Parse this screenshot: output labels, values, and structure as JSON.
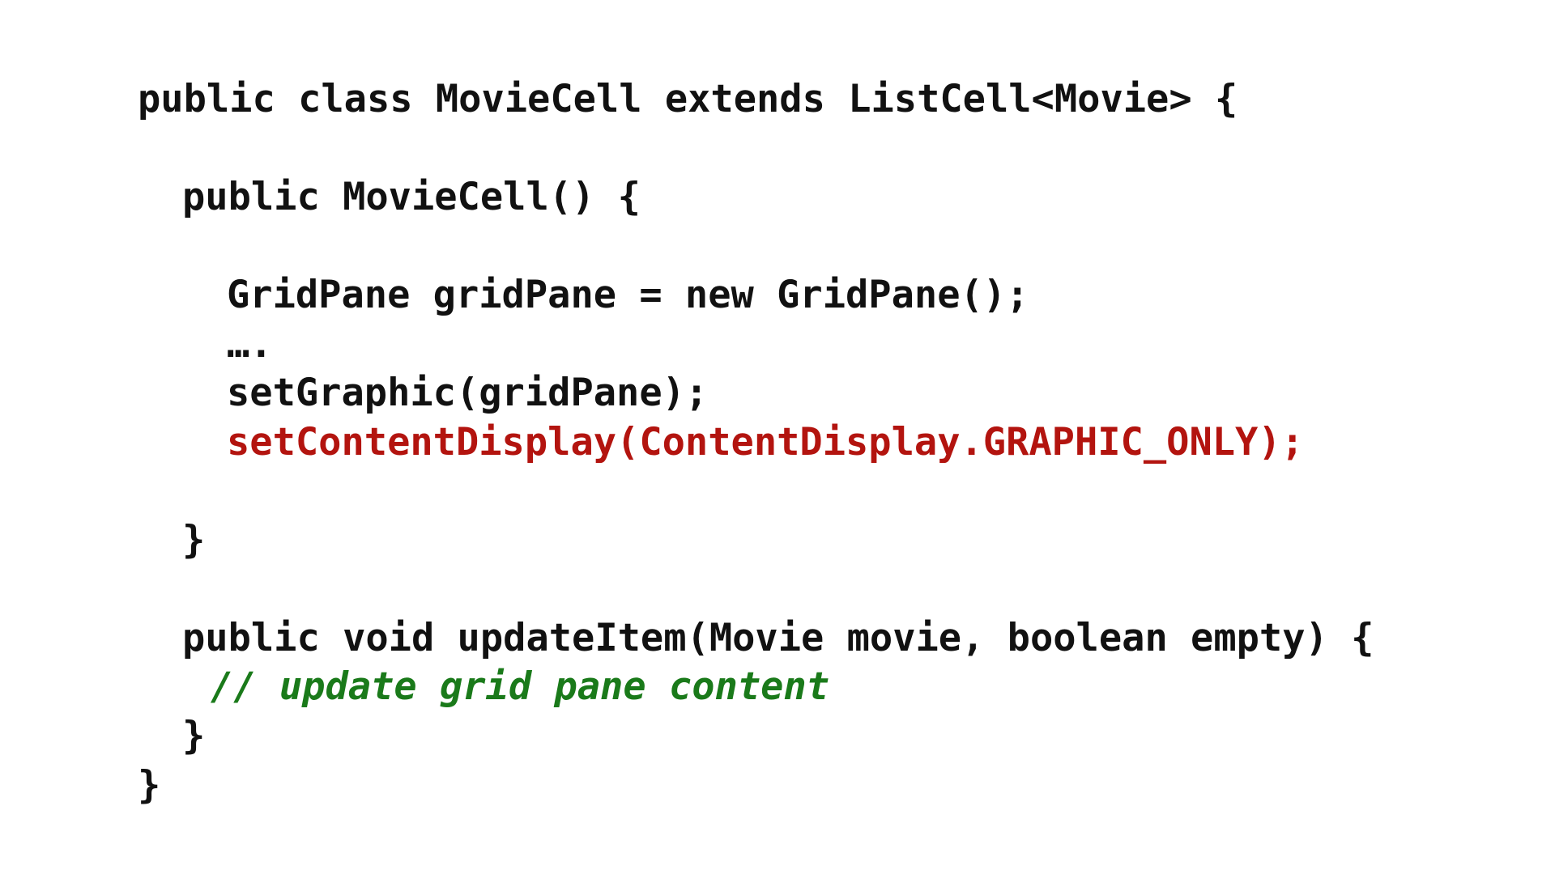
{
  "code": {
    "line_class_decl": "public class MovieCell extends ListCell<Movie> {",
    "line_constructor_decl": "public MovieCell() {",
    "line_gridpane": "GridPane gridPane = new GridPane();",
    "line_ellipsis": "….",
    "line_set_graphic": "setGraphic(gridPane);",
    "line_set_content_display": "setContentDisplay(ContentDisplay.GRAPHIC_ONLY);",
    "line_constructor_close": "}",
    "line_update_item_decl": "public void updateItem(Movie movie, boolean empty) {",
    "line_comment": "// update grid pane content",
    "line_update_item_close": "}",
    "line_class_close": "}"
  },
  "colors": {
    "text": "#111111",
    "highlight": "#b3140f",
    "comment": "#1a7a1a",
    "background": "#ffffff"
  }
}
